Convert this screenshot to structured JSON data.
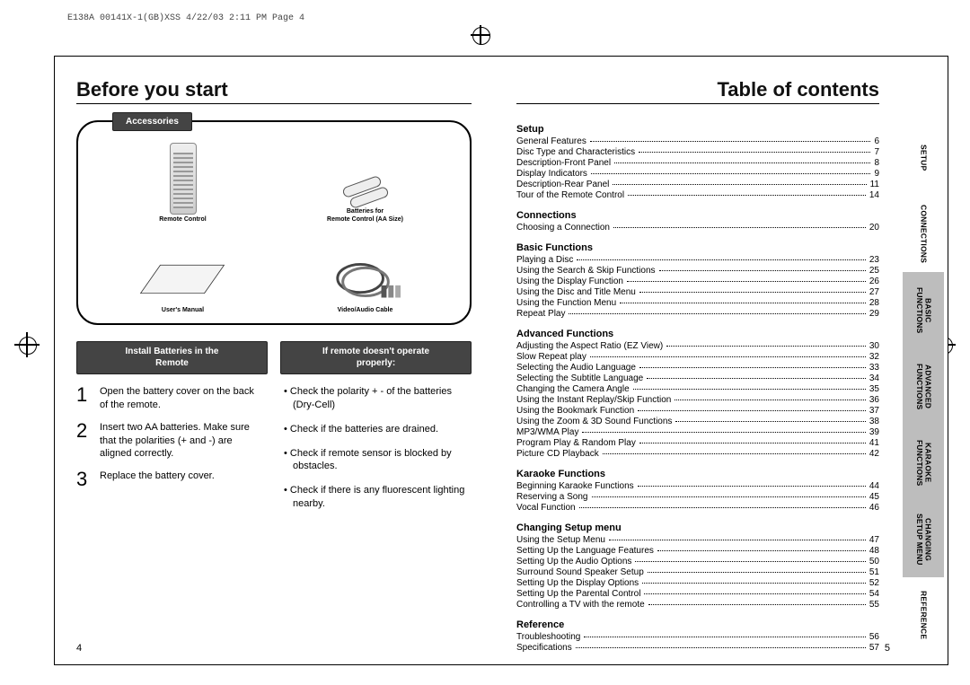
{
  "header_meta": "E138A 00141X-1(GB)XSS  4/22/03 2:11 PM  Page 4",
  "left_title": "Before you start",
  "right_title": "Table of contents",
  "accessories": {
    "label": "Accessories",
    "items": [
      {
        "caption": "Remote Control"
      },
      {
        "caption_line1": "Batteries for",
        "caption_line2": "Remote Control (AA Size)"
      },
      {
        "caption": "User's Manual"
      },
      {
        "caption": "Video/Audio Cable"
      }
    ]
  },
  "install_heading": "Install Batteries in the\nRemote",
  "remote_heading": "If remote doesn't operate\nproperly:",
  "steps": [
    "Open the battery cover on the back of the remote.",
    "Insert two AA batteries. Make sure that the polarities (+ and -) are aligned correctly.",
    "Replace the battery cover."
  ],
  "tips": [
    "• Check the polarity + - of the batteries (Dry-Cell)",
    "• Check if the batteries are drained.",
    "• Check if remote sensor is blocked by obstacles.",
    "• Check if there is any fluorescent lighting nearby."
  ],
  "page_left": "4",
  "page_right": "5",
  "tabs": [
    "SETUP",
    "CONNECTIONS",
    "BASIC\nFUNCTIONS",
    "ADVANCED\nFUNCTIONS",
    "KARAOKE\nFUNCTIONS",
    "CHANGING\nSETUP MENU",
    "REFERENCE"
  ],
  "toc": [
    {
      "section": "Setup",
      "items": [
        {
          "t": "General Features",
          "p": "6"
        },
        {
          "t": "Disc Type and Characteristics",
          "p": "7"
        },
        {
          "t": "Description-Front Panel",
          "p": "8"
        },
        {
          "t": "Display Indicators",
          "p": "9"
        },
        {
          "t": "Description-Rear Panel",
          "p": "11"
        },
        {
          "t": "Tour of the Remote Control",
          "p": "14"
        }
      ]
    },
    {
      "section": "Connections",
      "items": [
        {
          "t": "Choosing a Connection",
          "p": "20"
        }
      ]
    },
    {
      "section": "Basic Functions",
      "items": [
        {
          "t": "Playing a Disc",
          "p": "23"
        },
        {
          "t": "Using the Search & Skip Functions",
          "p": "25"
        },
        {
          "t": "Using the Display Function",
          "p": "26"
        },
        {
          "t": "Using the Disc and Title Menu",
          "p": "27"
        },
        {
          "t": "Using the Function Menu",
          "p": "28"
        },
        {
          "t": "Repeat Play",
          "p": "29"
        }
      ]
    },
    {
      "section": "Advanced Functions",
      "items": [
        {
          "t": "Adjusting the Aspect Ratio (EZ View)",
          "p": "30"
        },
        {
          "t": "Slow Repeat play",
          "p": "32"
        },
        {
          "t": "Selecting the Audio Language",
          "p": "33"
        },
        {
          "t": "Selecting the Subtitle Language",
          "p": "34"
        },
        {
          "t": "Changing the Camera Angle",
          "p": "35"
        },
        {
          "t": "Using the Instant Replay/Skip Function",
          "p": "36"
        },
        {
          "t": "Using the Bookmark Function",
          "p": "37"
        },
        {
          "t": "Using the Zoom & 3D Sound Functions",
          "p": "38"
        },
        {
          "t": "MP3/WMA Play",
          "p": "39"
        },
        {
          "t": "Program Play & Random Play",
          "p": "41"
        },
        {
          "t": "Picture CD Playback",
          "p": "42"
        }
      ]
    },
    {
      "section": "Karaoke Functions",
      "items": [
        {
          "t": "Beginning Karaoke Functions",
          "p": "44"
        },
        {
          "t": "Reserving a Song",
          "p": "45"
        },
        {
          "t": "Vocal Function",
          "p": "46"
        }
      ]
    },
    {
      "section": "Changing Setup menu",
      "items": [
        {
          "t": "Using the Setup Menu",
          "p": "47"
        },
        {
          "t": "Setting Up the Language Features",
          "p": "48"
        },
        {
          "t": "Setting Up the Audio Options",
          "p": "50"
        },
        {
          "t": "Surround Sound Speaker Setup",
          "p": "51"
        },
        {
          "t": "Setting Up the Display Options",
          "p": "52"
        },
        {
          "t": "Setting Up the Parental Control",
          "p": "54"
        },
        {
          "t": "Controlling a TV with the remote",
          "p": "55"
        }
      ]
    },
    {
      "section": "Reference",
      "items": [
        {
          "t": "Troubleshooting",
          "p": "56"
        },
        {
          "t": "Specifications",
          "p": "57"
        }
      ]
    }
  ]
}
